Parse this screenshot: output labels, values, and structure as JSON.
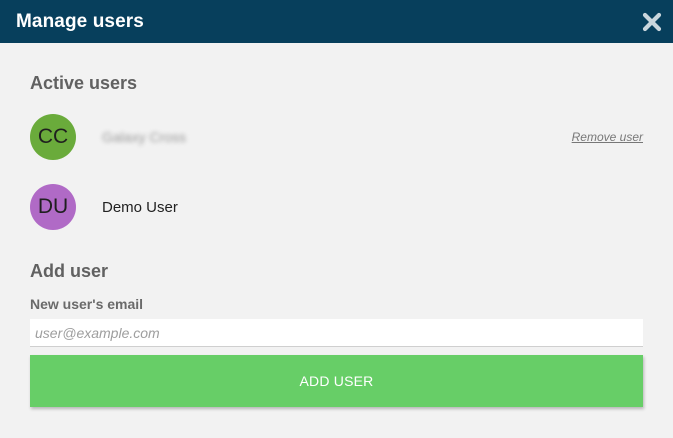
{
  "header": {
    "title": "Manage users",
    "close_icon": "close-icon"
  },
  "active_users": {
    "title": "Active users",
    "users": [
      {
        "initials": "CC",
        "name": "Galaxy Cross",
        "avatar_color": "#6aab3b",
        "action": "Remove user"
      },
      {
        "initials": "DU",
        "name": "Demo User",
        "avatar_color": "#b06ac6"
      }
    ]
  },
  "add_user": {
    "title": "Add user",
    "email_label": "New user's email",
    "email_placeholder": "user@example.com",
    "email_value": "",
    "button_label": "ADD USER"
  },
  "colors": {
    "header_bg": "#073f5c",
    "button_bg": "#67ce67",
    "background": "#f2f2f2"
  }
}
